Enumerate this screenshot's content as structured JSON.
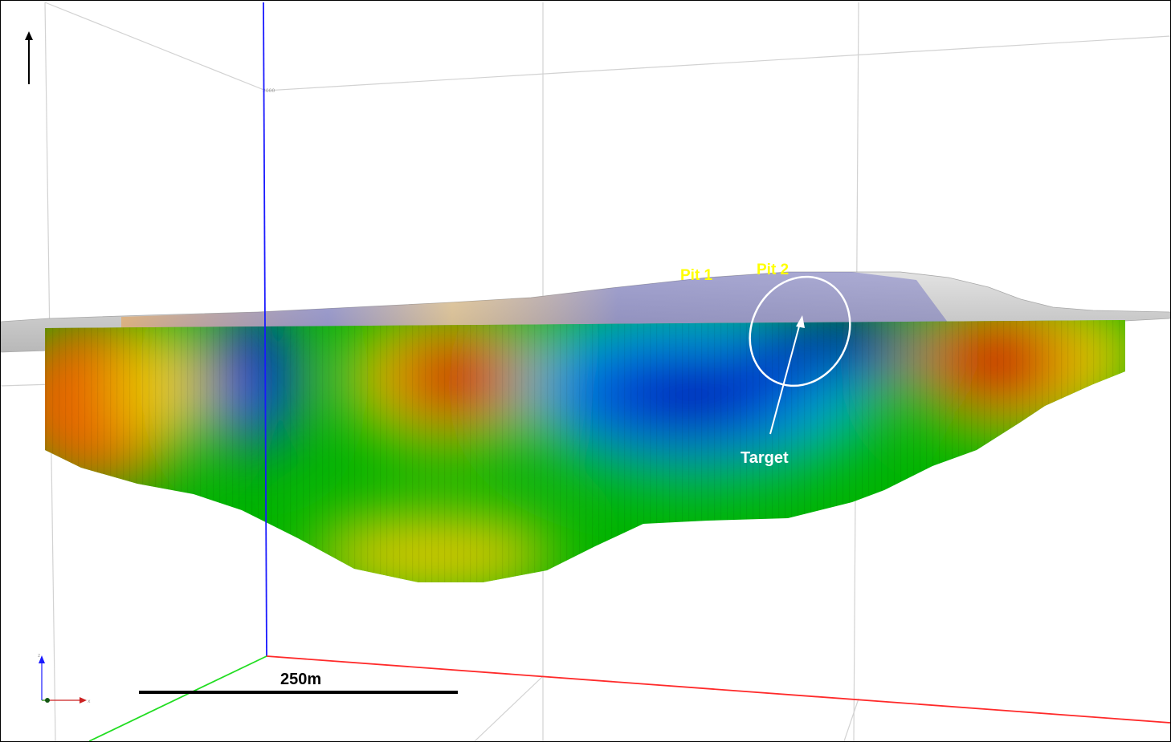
{
  "labels": {
    "pit1": "Pit 1",
    "pit2": "Pit 2",
    "target": "Target",
    "scale_bar": "250m"
  },
  "axis_triad": {
    "z": "z",
    "x": "x"
  },
  "grid_tick_label": "2000",
  "colors": {
    "label_yellow": "#ffff00",
    "label_white": "#ffffff",
    "axis_blue": "#1a1aff",
    "axis_red": "#ff2a2a",
    "axis_green": "#22dd22",
    "grid": "#d2d2d2",
    "terrain": "#c9c9c9",
    "colormap": [
      "#0000b4",
      "#0050e0",
      "#00b4c8",
      "#00b400",
      "#8cc800",
      "#e6c800",
      "#e66400",
      "#c80000"
    ]
  },
  "icons": {
    "north": "up-arrow-icon"
  }
}
